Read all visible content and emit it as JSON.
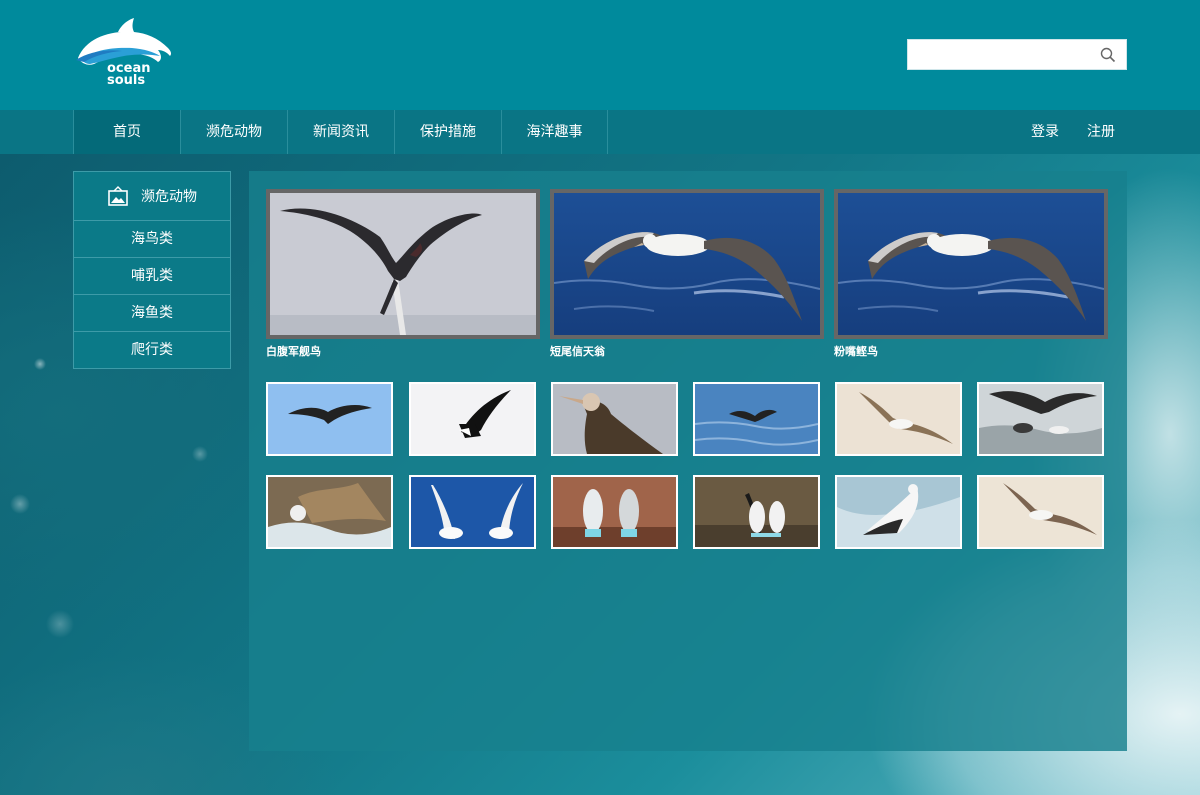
{
  "brand": {
    "line1": "ocean",
    "line2": "souls"
  },
  "search": {
    "placeholder": "",
    "value": ""
  },
  "nav": {
    "items": [
      "首页",
      "濒危动物",
      "新闻资讯",
      "保护措施",
      "海洋趣事"
    ],
    "active_index": 0,
    "login": "登录",
    "register": "注册"
  },
  "sidebar": {
    "title": "濒危动物",
    "items": [
      "海鸟类",
      "哺乳类",
      "海鱼类",
      "爬行类"
    ]
  },
  "featured": [
    {
      "caption": "白腹军舰鸟"
    },
    {
      "caption": "短尾信天翁"
    },
    {
      "caption": "粉嘴鲣鸟"
    }
  ],
  "colors": {
    "header": "#008a9c",
    "nav": "#0a7585",
    "nav_active": "#046a79",
    "panel": "#17808e"
  }
}
